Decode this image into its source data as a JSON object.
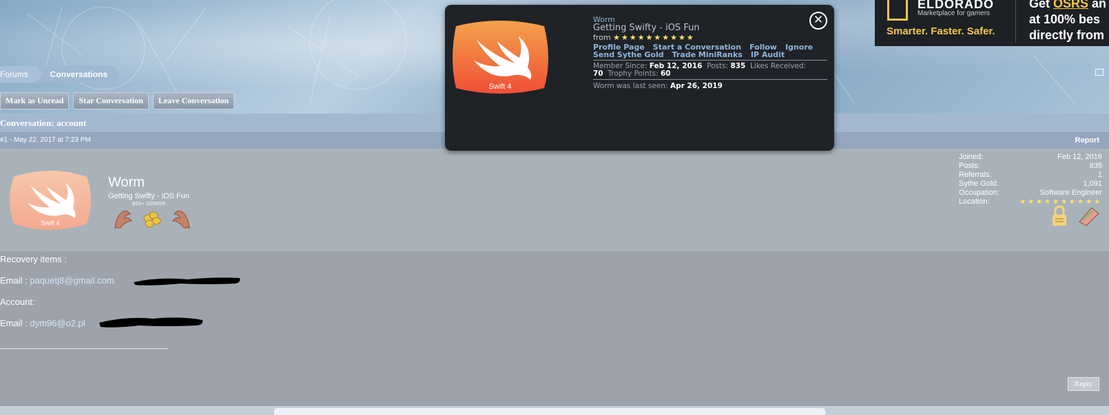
{
  "ad": {
    "brand": "ELDORADO",
    "market": "Marketplace for gamers",
    "tagline": "Smarter. Faster. Safer.",
    "promo_line1": "Get ",
    "promo_highlight": "OSRS",
    "promo_line1_end": " an",
    "promo_line2": "at 100% bes",
    "promo_line3": "directly from"
  },
  "breadcrumb": {
    "items": [
      "Forums",
      "Conversations"
    ]
  },
  "actions": {
    "mark_unread": "Mark as Unread",
    "star": "Star Conversation",
    "leave": "Leave Conversation"
  },
  "conversation": {
    "title": "Conversation: account"
  },
  "post": {
    "permalink": "#1 - May 22, 2017 at 7:23 PM",
    "report": "Report",
    "reply": "Reply",
    "username": "Worm",
    "user_title": "Getting Swifty - iOS Fun",
    "badge": "$50+ DONOR",
    "avatar_label": "Swift 4",
    "lines": [
      "Recovery items :",
      "Email : ",
      "Account:",
      "Email : "
    ],
    "email1": "paquetj8@gmail.com",
    "email2": "dym96@o2.pl"
  },
  "stats": [
    {
      "label": "Joined:",
      "value": "Feb 12, 2016"
    },
    {
      "label": "Posts:",
      "value": "835"
    },
    {
      "label": "Referrals:",
      "value": "1"
    },
    {
      "label": "Sythe Gold:",
      "value": "1,091"
    },
    {
      "label": "Occupation:",
      "value": "Software Engineer"
    }
  ],
  "location_label": "Location:",
  "card": {
    "name": "Worm",
    "title": "Getting Swifty - iOS Fun",
    "from": "from",
    "avatar_label": "Swift 4",
    "links": [
      "Profile Page",
      "Start a Conversation",
      "Follow",
      "Ignore",
      "Send Sythe Gold",
      "Trade MiniRanks",
      "IP Audit"
    ],
    "member_since_label": "Member Since:",
    "member_since": "Feb 12, 2016",
    "posts_label": "Posts:",
    "posts": "835",
    "likes_label": "Likes Received:",
    "likes": "70",
    "trophy_label": "Trophy Points:",
    "trophy": "60",
    "last_seen_label": "Worm was last seen:",
    "last_seen": "Apr 26, 2019"
  },
  "colors": {
    "swift_orange_top": "#f4a24a",
    "swift_orange_bottom": "#ef4f36",
    "link_blue": "#8fb4d9",
    "gold": "#ffe36b"
  }
}
